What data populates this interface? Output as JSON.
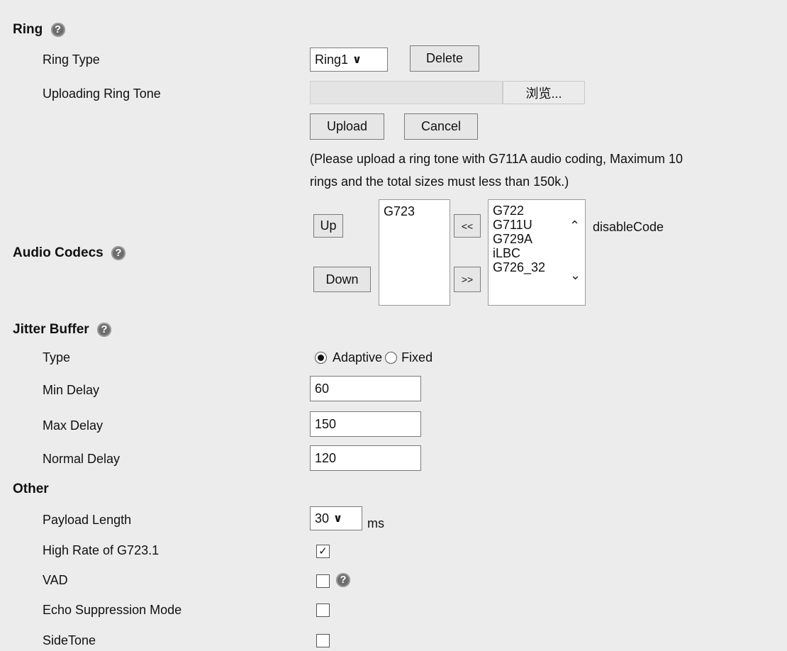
{
  "sections": {
    "ring": "Ring",
    "audio_codecs": "Audio Codecs",
    "jitter_buffer": "Jitter Buffer",
    "other": "Other"
  },
  "ring": {
    "type_label": "Ring Type",
    "type_value": "Ring1",
    "delete_label": "Delete",
    "upload_tone_label": "Uploading Ring Tone",
    "browse_label": "浏览...",
    "upload_label": "Upload",
    "cancel_label": "Cancel",
    "note_line1": "(Please upload a ring tone with G711A audio coding, Maximum 10",
    "note_line2": "rings and the total sizes must less than 150k.)"
  },
  "codecs": {
    "up_label": "Up",
    "down_label": "Down",
    "move_left_label": "<<",
    "move_right_label": ">>",
    "enabled": [
      "G723"
    ],
    "disabled": [
      "G722",
      "G711U",
      "G729A",
      "iLBC",
      "G726_32"
    ],
    "disabled_caption": "disableCode"
  },
  "jitter": {
    "type_label": "Type",
    "adaptive_label": "Adaptive",
    "fixed_label": "Fixed",
    "selected": "Adaptive",
    "min_label": "Min Delay",
    "min_value": "60",
    "max_label": "Max Delay",
    "max_value": "150",
    "normal_label": "Normal Delay",
    "normal_value": "120"
  },
  "other": {
    "payload_label": "Payload Length",
    "payload_value": "30",
    "payload_unit": "ms",
    "high_rate_label": "High Rate of G723.1",
    "high_rate_checked": true,
    "vad_label": "VAD",
    "vad_checked": false,
    "echo_label": "Echo Suppression Mode",
    "echo_checked": false,
    "sidetone_label": "SideTone",
    "sidetone_checked": false
  },
  "icons": {
    "help": "question-circle-icon",
    "chevron": "chevron-down-icon",
    "check": "checkmark-icon"
  },
  "help_glyph": "?",
  "check_glyph": "✓"
}
